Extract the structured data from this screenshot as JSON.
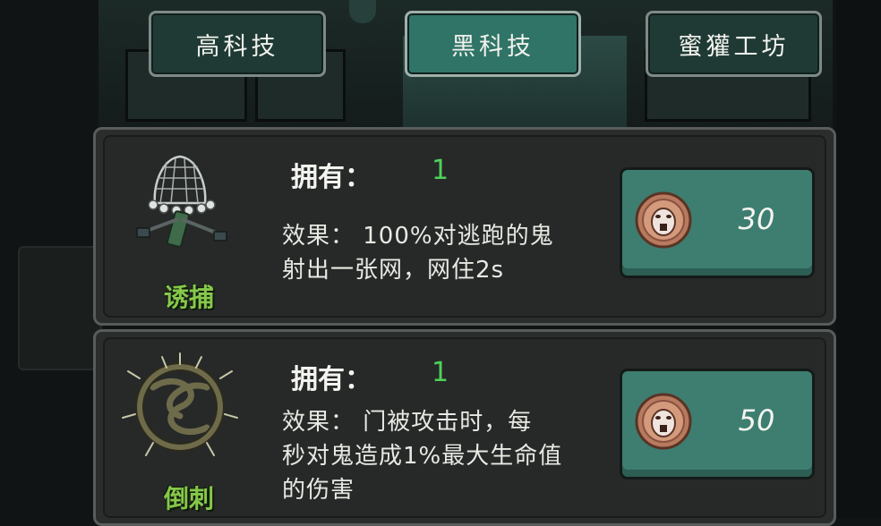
{
  "tabs": [
    {
      "label": "高科技",
      "active": false
    },
    {
      "label": "黑科技",
      "active": true
    },
    {
      "label": "蜜獾工坊",
      "active": false
    }
  ],
  "items": [
    {
      "name": "诱捕",
      "icon": "net-icon",
      "own_label": "拥有：",
      "own_value": "1",
      "effect_line1": "效果：   100%对逃跑的鬼",
      "effect_line2": "射出一张网，网住2s",
      "effect_line3": "",
      "price": "30",
      "currency_icon": "badger-coin-icon"
    },
    {
      "name": "倒刺",
      "icon": "thorn-ring-icon",
      "own_label": "拥有：",
      "own_value": "1",
      "effect_line1": "效果：   门被攻击时，每",
      "effect_line2": "秒对鬼造成1%最大生命值",
      "effect_line3": "的伤害",
      "price": "50",
      "currency_icon": "badger-coin-icon"
    }
  ],
  "colors": {
    "tab_active": "#2f7466",
    "tab_inactive": "#1f3a34",
    "buy_button": "#3d7e70",
    "item_name": "#86c84a",
    "own_value": "#4fd15a"
  }
}
